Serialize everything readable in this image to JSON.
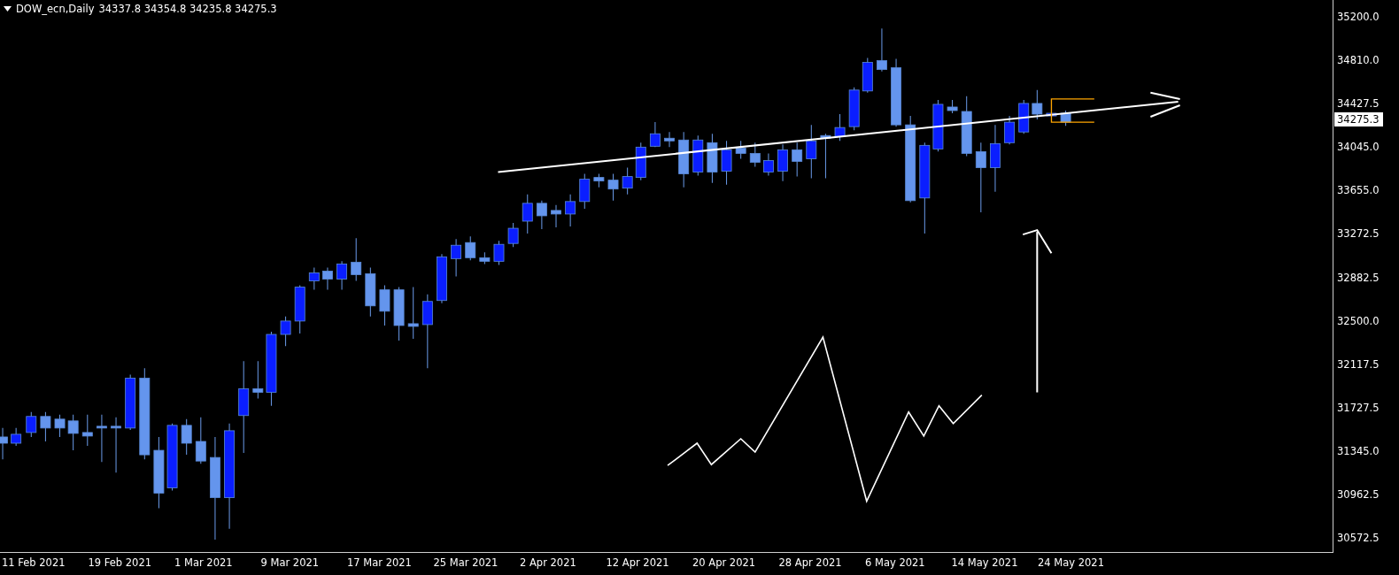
{
  "chart": {
    "symbol": "DOW_ecn,Daily",
    "ohlc": "34337.8 34354.8 34235.8 34275.3",
    "price_axis": [
      "35200.0",
      "34810.0",
      "34427.5",
      "34045.0",
      "33655.0",
      "33272.5",
      "32882.5",
      "32500.0",
      "32117.5",
      "31727.5",
      "31345.0",
      "30962.5",
      "30572.5"
    ],
    "current_price": "34275.3",
    "date_axis": [
      "11 Feb 2021",
      "19 Feb 2021",
      "1 Mar 2021",
      "9 Mar 2021",
      "17 Mar 2021",
      "25 Mar 2021",
      "2 Apr 2021",
      "12 Apr 2021",
      "20 Apr 2021",
      "28 Apr 2021",
      "6 May 2021",
      "14 May 2021",
      "24 May 2021"
    ]
  }
}
